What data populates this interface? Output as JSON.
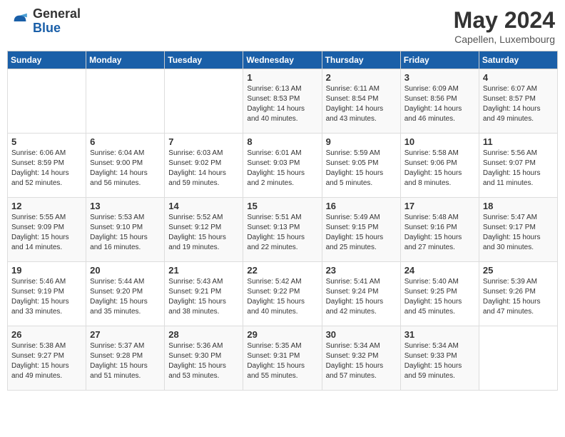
{
  "logo": {
    "general": "General",
    "blue": "Blue"
  },
  "title": "May 2024",
  "location": "Capellen, Luxembourg",
  "weekdays": [
    "Sunday",
    "Monday",
    "Tuesday",
    "Wednesday",
    "Thursday",
    "Friday",
    "Saturday"
  ],
  "weeks": [
    [
      {
        "day": "",
        "sunrise": "",
        "sunset": "",
        "daylight": ""
      },
      {
        "day": "",
        "sunrise": "",
        "sunset": "",
        "daylight": ""
      },
      {
        "day": "",
        "sunrise": "",
        "sunset": "",
        "daylight": ""
      },
      {
        "day": "1",
        "sunrise": "Sunrise: 6:13 AM",
        "sunset": "Sunset: 8:53 PM",
        "daylight": "Daylight: 14 hours and 40 minutes."
      },
      {
        "day": "2",
        "sunrise": "Sunrise: 6:11 AM",
        "sunset": "Sunset: 8:54 PM",
        "daylight": "Daylight: 14 hours and 43 minutes."
      },
      {
        "day": "3",
        "sunrise": "Sunrise: 6:09 AM",
        "sunset": "Sunset: 8:56 PM",
        "daylight": "Daylight: 14 hours and 46 minutes."
      },
      {
        "day": "4",
        "sunrise": "Sunrise: 6:07 AM",
        "sunset": "Sunset: 8:57 PM",
        "daylight": "Daylight: 14 hours and 49 minutes."
      }
    ],
    [
      {
        "day": "5",
        "sunrise": "Sunrise: 6:06 AM",
        "sunset": "Sunset: 8:59 PM",
        "daylight": "Daylight: 14 hours and 52 minutes."
      },
      {
        "day": "6",
        "sunrise": "Sunrise: 6:04 AM",
        "sunset": "Sunset: 9:00 PM",
        "daylight": "Daylight: 14 hours and 56 minutes."
      },
      {
        "day": "7",
        "sunrise": "Sunrise: 6:03 AM",
        "sunset": "Sunset: 9:02 PM",
        "daylight": "Daylight: 14 hours and 59 minutes."
      },
      {
        "day": "8",
        "sunrise": "Sunrise: 6:01 AM",
        "sunset": "Sunset: 9:03 PM",
        "daylight": "Daylight: 15 hours and 2 minutes."
      },
      {
        "day": "9",
        "sunrise": "Sunrise: 5:59 AM",
        "sunset": "Sunset: 9:05 PM",
        "daylight": "Daylight: 15 hours and 5 minutes."
      },
      {
        "day": "10",
        "sunrise": "Sunrise: 5:58 AM",
        "sunset": "Sunset: 9:06 PM",
        "daylight": "Daylight: 15 hours and 8 minutes."
      },
      {
        "day": "11",
        "sunrise": "Sunrise: 5:56 AM",
        "sunset": "Sunset: 9:07 PM",
        "daylight": "Daylight: 15 hours and 11 minutes."
      }
    ],
    [
      {
        "day": "12",
        "sunrise": "Sunrise: 5:55 AM",
        "sunset": "Sunset: 9:09 PM",
        "daylight": "Daylight: 15 hours and 14 minutes."
      },
      {
        "day": "13",
        "sunrise": "Sunrise: 5:53 AM",
        "sunset": "Sunset: 9:10 PM",
        "daylight": "Daylight: 15 hours and 16 minutes."
      },
      {
        "day": "14",
        "sunrise": "Sunrise: 5:52 AM",
        "sunset": "Sunset: 9:12 PM",
        "daylight": "Daylight: 15 hours and 19 minutes."
      },
      {
        "day": "15",
        "sunrise": "Sunrise: 5:51 AM",
        "sunset": "Sunset: 9:13 PM",
        "daylight": "Daylight: 15 hours and 22 minutes."
      },
      {
        "day": "16",
        "sunrise": "Sunrise: 5:49 AM",
        "sunset": "Sunset: 9:15 PM",
        "daylight": "Daylight: 15 hours and 25 minutes."
      },
      {
        "day": "17",
        "sunrise": "Sunrise: 5:48 AM",
        "sunset": "Sunset: 9:16 PM",
        "daylight": "Daylight: 15 hours and 27 minutes."
      },
      {
        "day": "18",
        "sunrise": "Sunrise: 5:47 AM",
        "sunset": "Sunset: 9:17 PM",
        "daylight": "Daylight: 15 hours and 30 minutes."
      }
    ],
    [
      {
        "day": "19",
        "sunrise": "Sunrise: 5:46 AM",
        "sunset": "Sunset: 9:19 PM",
        "daylight": "Daylight: 15 hours and 33 minutes."
      },
      {
        "day": "20",
        "sunrise": "Sunrise: 5:44 AM",
        "sunset": "Sunset: 9:20 PM",
        "daylight": "Daylight: 15 hours and 35 minutes."
      },
      {
        "day": "21",
        "sunrise": "Sunrise: 5:43 AM",
        "sunset": "Sunset: 9:21 PM",
        "daylight": "Daylight: 15 hours and 38 minutes."
      },
      {
        "day": "22",
        "sunrise": "Sunrise: 5:42 AM",
        "sunset": "Sunset: 9:22 PM",
        "daylight": "Daylight: 15 hours and 40 minutes."
      },
      {
        "day": "23",
        "sunrise": "Sunrise: 5:41 AM",
        "sunset": "Sunset: 9:24 PM",
        "daylight": "Daylight: 15 hours and 42 minutes."
      },
      {
        "day": "24",
        "sunrise": "Sunrise: 5:40 AM",
        "sunset": "Sunset: 9:25 PM",
        "daylight": "Daylight: 15 hours and 45 minutes."
      },
      {
        "day": "25",
        "sunrise": "Sunrise: 5:39 AM",
        "sunset": "Sunset: 9:26 PM",
        "daylight": "Daylight: 15 hours and 47 minutes."
      }
    ],
    [
      {
        "day": "26",
        "sunrise": "Sunrise: 5:38 AM",
        "sunset": "Sunset: 9:27 PM",
        "daylight": "Daylight: 15 hours and 49 minutes."
      },
      {
        "day": "27",
        "sunrise": "Sunrise: 5:37 AM",
        "sunset": "Sunset: 9:28 PM",
        "daylight": "Daylight: 15 hours and 51 minutes."
      },
      {
        "day": "28",
        "sunrise": "Sunrise: 5:36 AM",
        "sunset": "Sunset: 9:30 PM",
        "daylight": "Daylight: 15 hours and 53 minutes."
      },
      {
        "day": "29",
        "sunrise": "Sunrise: 5:35 AM",
        "sunset": "Sunset: 9:31 PM",
        "daylight": "Daylight: 15 hours and 55 minutes."
      },
      {
        "day": "30",
        "sunrise": "Sunrise: 5:34 AM",
        "sunset": "Sunset: 9:32 PM",
        "daylight": "Daylight: 15 hours and 57 minutes."
      },
      {
        "day": "31",
        "sunrise": "Sunrise: 5:34 AM",
        "sunset": "Sunset: 9:33 PM",
        "daylight": "Daylight: 15 hours and 59 minutes."
      },
      {
        "day": "",
        "sunrise": "",
        "sunset": "",
        "daylight": ""
      }
    ]
  ]
}
